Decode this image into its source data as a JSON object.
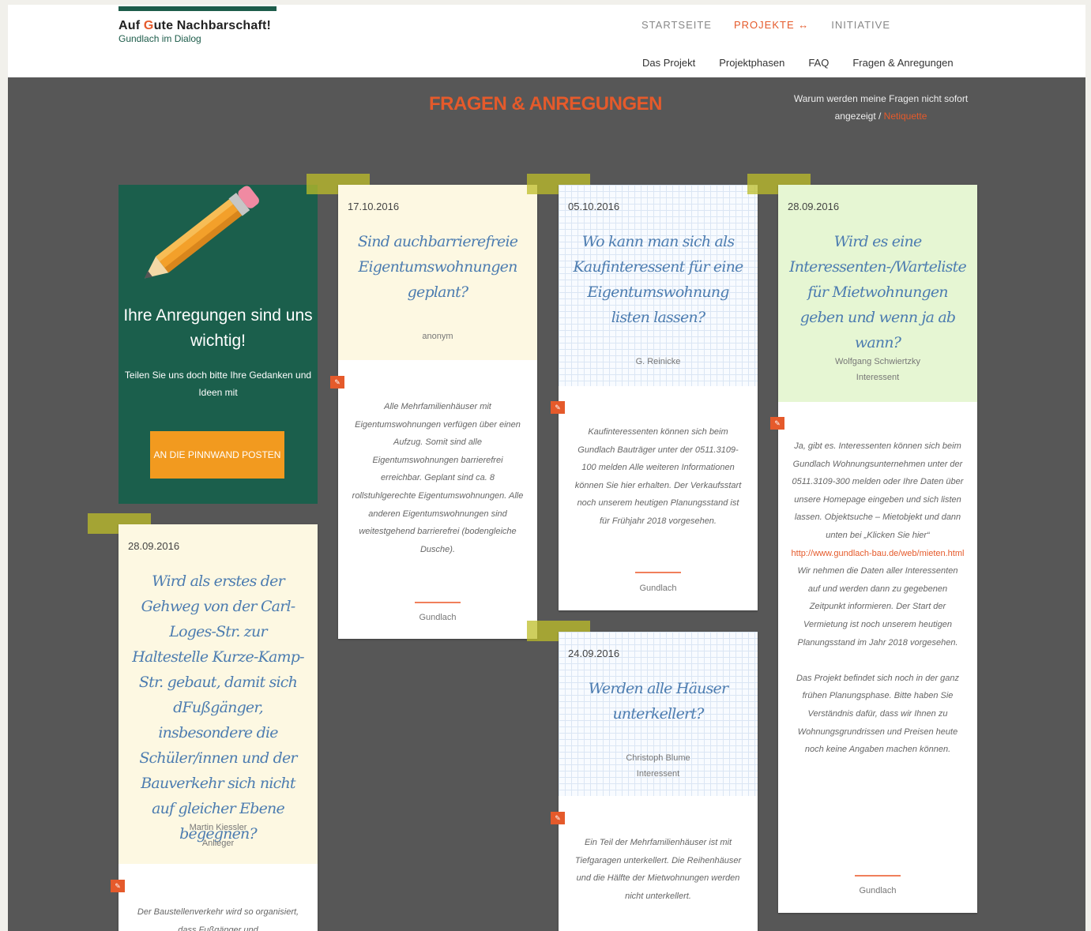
{
  "header": {
    "logo_pre": "Auf ",
    "logo_accent": "G",
    "logo_post": "ute Nachbarschaft!",
    "logo_subtitle": "Gundlach im Dialog",
    "main_nav": [
      "STARTSEITE",
      "PROJEKTE ↔",
      "INITIATIVE"
    ],
    "sub_nav": [
      "Das Projekt",
      "Projektphasen",
      "FAQ",
      "Fragen & Anregungen"
    ]
  },
  "board": {
    "title": "FRAGEN & ANREGUNGEN",
    "note_text": "Warum werden meine Fragen nicht sofort angezeigt / ",
    "note_link": "Netiquette"
  },
  "intro": {
    "title": "Ihre Anregungen sind uns wichtig!",
    "text": "Teilen Sie uns doch bitte Ihre Gedanken und Ideen mit",
    "button": "AN DIE PINNWAND POSTEN"
  },
  "cards": [
    {
      "date": "17.10.2016",
      "question": "Sind auchbarrierefreie Eigentumswohnungen geplant?",
      "author": "anonym",
      "author_role": "",
      "answer": "Alle Mehrfamilienhäuser mit Eigentumswohnungen verfügen über einen Aufzug. Somit sind alle Eigentumswohnungen barrierefrei erreichbar. Geplant sind ca. 8 rollstuhlgerechte Eigentumswohnungen. Alle anderen Eigentumswohnungen sind weitestgehend barrierefrei (bodengleiche Dusche).",
      "answer2": "",
      "url": "",
      "answer_after_url": "",
      "signer": "Gundlach"
    },
    {
      "date": "05.10.2016",
      "question": "Wo kann man sich als Kaufinteressent für eine Eigentumswohnung listen lassen?",
      "author": "G. Reinicke",
      "author_role": "",
      "answer": "Kaufinteressenten können sich beim Gundlach Bauträger unter der 0511.3109-100 melden Alle weiteren Informationen können Sie hier erhalten. Der Verkaufsstart noch unserem heutigen Planungsstand ist für Frühjahr 2018 vorgesehen.",
      "answer2": "",
      "url": "",
      "answer_after_url": "",
      "signer": "Gundlach"
    },
    {
      "date": "28.09.2016",
      "question": "Wird es eine Interessenten-/Warteliste für Mietwohnungen geben und wenn ja ab wann?",
      "author": "Wolfgang Schwiertzky",
      "author_role": "Interessent",
      "answer": "Ja, gibt es. Interessenten können sich beim Gundlach Wohnungsunternehmen unter der 0511.3109-300 melden oder Ihre Daten über unsere Homepage eingeben und sich listen lassen. Objektsuche – Mietobjekt und dann unten bei „Klicken Sie hier“",
      "url": "http://www.gundlach-bau.de/web/mieten.html",
      "answer_after_url": "Wir nehmen die Daten aller Interessenten auf und werden dann zu gegebenen Zeitpunkt informieren. Der Start der Vermietung ist noch unserem heutigen Planungsstand im Jahr 2018 vorgesehen.",
      "answer2": "Das Projekt befindet sich noch in der ganz frühen Planungsphase. Bitte haben Sie Verständnis dafür, dass wir Ihnen zu Wohnungsgrundrissen und Preisen heute noch keine Angaben machen können.",
      "signer": "Gundlach"
    },
    {
      "date": "28.09.2016",
      "question": "Wird als erstes der Gehweg von der Carl-Loges-Str. zur Haltestelle Kurze-Kamp-Str. gebaut, damit sich dFußgänger, insbesondere die Schüler/innen und der Bauverkehr sich nicht auf gleicher Ebene begegnen?",
      "author": "Martin Kiessler",
      "author_role": "Anlieger",
      "answer": "Der Baustellenverkehr wird so organisiert, dass Fußgänger und",
      "answer2": "",
      "url": "",
      "answer_after_url": "",
      "signer": ""
    },
    {
      "date": "24.09.2016",
      "question": "Werden alle Häuser unterkellert?",
      "author": "Christoph Blume",
      "author_role": "Interessent",
      "answer": "Ein Teil der Mehrfamilienhäuser ist mit Tiefgaragen unterkellert. Die Reihenhäuser und die Hälfte der Mietwohnungen werden nicht unterkellert.",
      "answer2": "",
      "url": "",
      "answer_after_url": "",
      "signer": ""
    }
  ],
  "colors": {
    "accent": "#e55a2b",
    "green": "#1b5f4c",
    "button": "#f29a1f",
    "board": "#575757"
  }
}
